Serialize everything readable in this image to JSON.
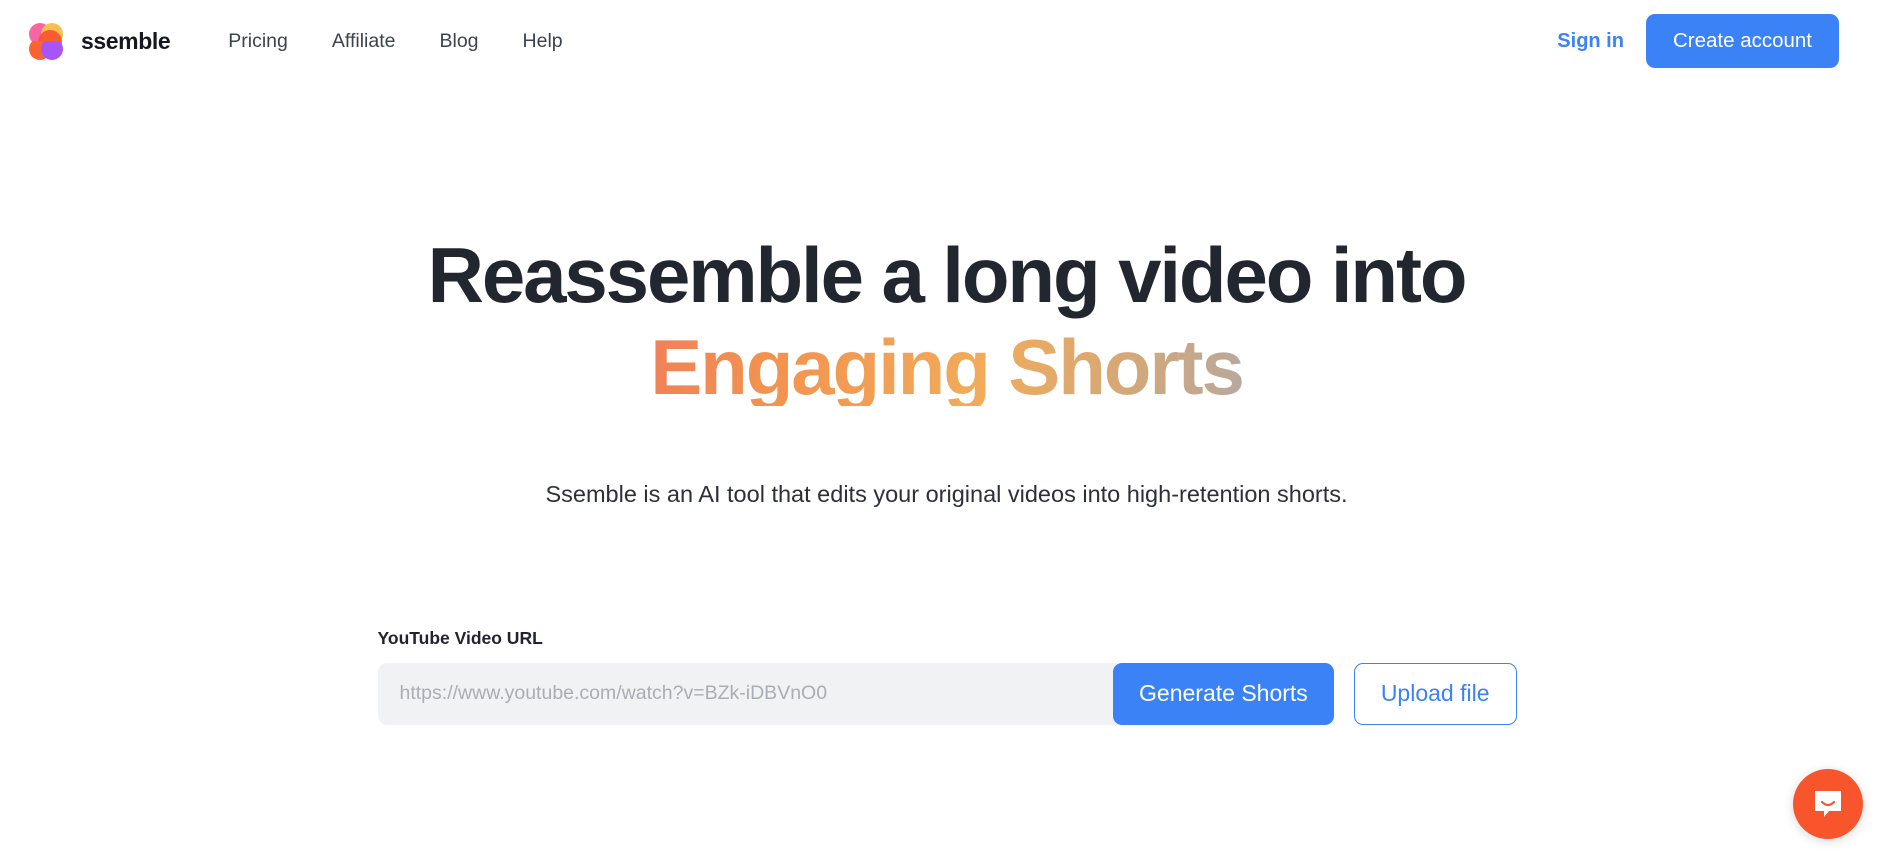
{
  "header": {
    "brand_name": "ssemble",
    "logo_icon": "ssemble-s-logo-icon",
    "nav": [
      {
        "label": "Pricing"
      },
      {
        "label": "Affiliate"
      },
      {
        "label": "Blog"
      },
      {
        "label": "Help"
      }
    ],
    "sign_in_label": "Sign in",
    "create_account_label": "Create account",
    "accent_color": "#3b82f6"
  },
  "hero": {
    "heading_line1": "Reassemble a long video into",
    "heading_line2": "Engaging Shorts",
    "heading_gradient_from": "#e8447c",
    "heading_gradient_mid": "#f2ab5a",
    "heading_gradient_to": "#4285f4",
    "subtitle": "Ssemble is an AI tool that edits your original videos into high-retention shorts."
  },
  "form": {
    "field_label": "YouTube Video URL",
    "url_value": "",
    "url_placeholder": "https://www.youtube.com/watch?v=BZk-iDBVnO0",
    "generate_label": "Generate Shorts",
    "upload_label": "Upload file"
  },
  "chat": {
    "icon": "chat-smile-bubble-icon",
    "color": "#f9552d"
  }
}
